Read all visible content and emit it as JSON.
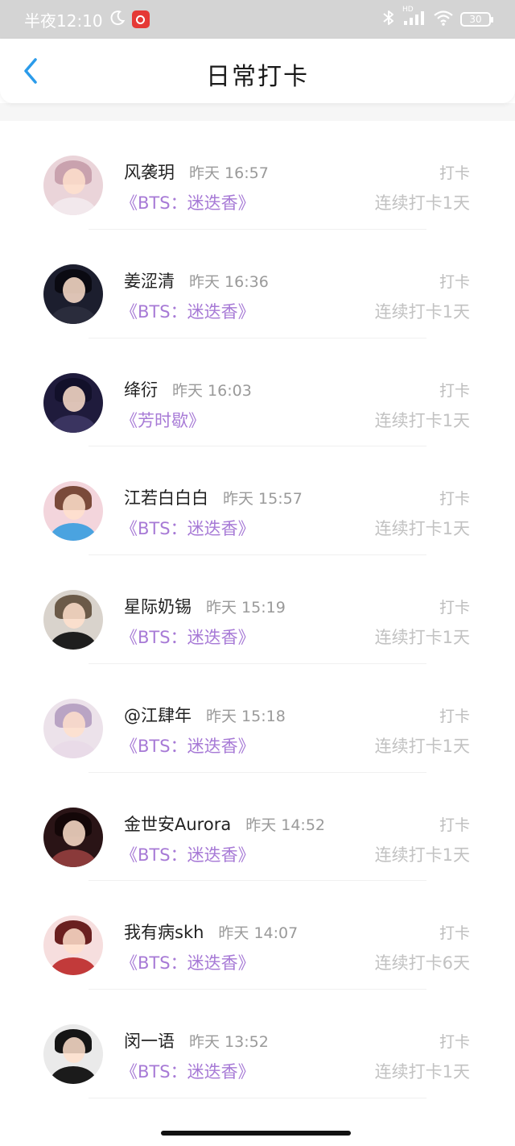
{
  "status_bar": {
    "time": "半夜12:10",
    "battery": "30",
    "hd_label": "HD",
    "icons": [
      "moon-icon",
      "netease-music-icon",
      "bluetooth-icon",
      "signal-icon",
      "wifi-icon",
      "battery-icon"
    ]
  },
  "header": {
    "title": "日常打卡",
    "back_icon": "chevron-left-icon"
  },
  "colors": {
    "accent_blue": "#2b9bea",
    "book_purple": "#a77ad6",
    "muted_gray": "#bdbdbd",
    "status_bar_bg": "#d4d4d4"
  },
  "items": [
    {
      "name": "风袭玥",
      "time": "昨天 16:57",
      "book": "《BTS：迷迭香》",
      "action": "打卡",
      "streak": "连续打卡1天",
      "avatar_tone": "#ead4d9",
      "avatar_hair": "#c9a2ae",
      "avatar_cloth": "#f2e8ec"
    },
    {
      "name": "姜涩清",
      "time": "昨天 16:36",
      "book": "《BTS：迷迭香》",
      "action": "打卡",
      "streak": "连续打卡1天",
      "avatar_tone": "#1c1e2e",
      "avatar_hair": "#0a0a12",
      "avatar_cloth": "#2a2c3c"
    },
    {
      "name": "绛衍",
      "time": "昨天 16:03",
      "book": "《芳时歇》",
      "action": "打卡",
      "streak": "连续打卡1天",
      "avatar_tone": "#1f1b3c",
      "avatar_hair": "#12102a",
      "avatar_cloth": "#3a3460"
    },
    {
      "name": "江若白白白",
      "time": "昨天 15:57",
      "book": "《BTS：迷迭香》",
      "action": "打卡",
      "streak": "连续打卡1天",
      "avatar_tone": "#f3d5dc",
      "avatar_hair": "#7a4a3a",
      "avatar_cloth": "#4aa3e0"
    },
    {
      "name": "星际奶锡",
      "time": "昨天 15:19",
      "book": "《BTS：迷迭香》",
      "action": "打卡",
      "streak": "连续打卡1天",
      "avatar_tone": "#d9d3cc",
      "avatar_hair": "#6b5a48",
      "avatar_cloth": "#1e1e1e"
    },
    {
      "name": "@江肆年",
      "time": "昨天 15:18",
      "book": "《BTS：迷迭香》",
      "action": "打卡",
      "streak": "连续打卡1天",
      "avatar_tone": "#ece2ea",
      "avatar_hair": "#b9a4c4",
      "avatar_cloth": "#e9dbe8"
    },
    {
      "name": "金世安Aurora",
      "time": "昨天 14:52",
      "book": "《BTS：迷迭香》",
      "action": "打卡",
      "streak": "连续打卡1天",
      "avatar_tone": "#2a1416",
      "avatar_hair": "#140708",
      "avatar_cloth": "#8a3a3a"
    },
    {
      "name": "我有病skh",
      "time": "昨天 14:07",
      "book": "《BTS：迷迭香》",
      "action": "打卡",
      "streak": "连续打卡6天",
      "avatar_tone": "#f6dede",
      "avatar_hair": "#6a2020",
      "avatar_cloth": "#c23a3a"
    },
    {
      "name": "闵一语",
      "time": "昨天 13:52",
      "book": "《BTS：迷迭香》",
      "action": "打卡",
      "streak": "连续打卡1天",
      "avatar_tone": "#eaeaea",
      "avatar_hair": "#151515",
      "avatar_cloth": "#1b1b1b"
    }
  ]
}
